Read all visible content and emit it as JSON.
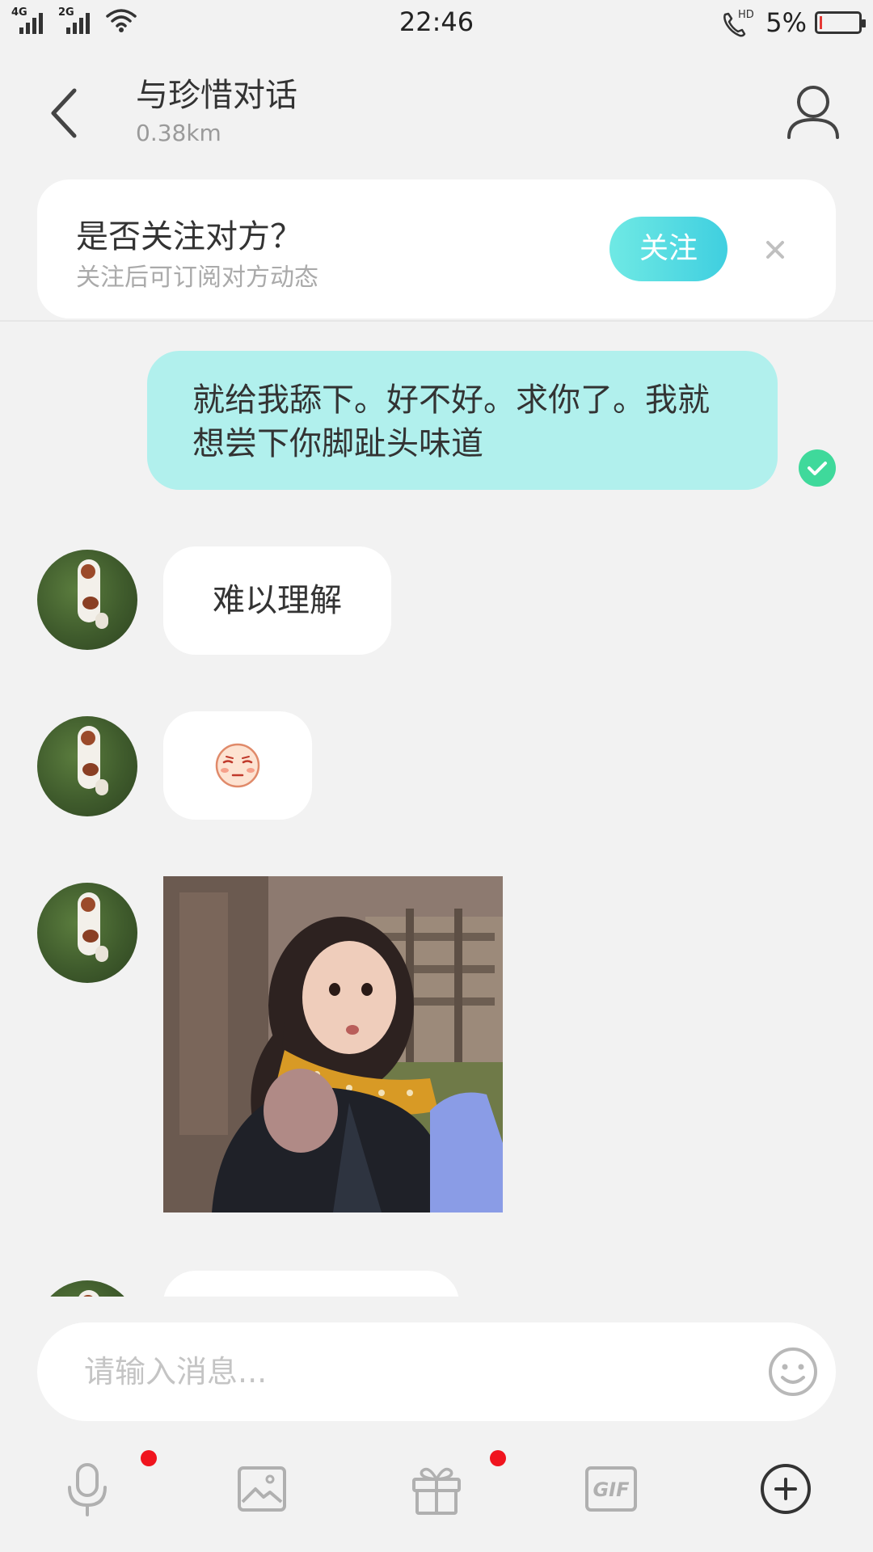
{
  "status_bar": {
    "network_1": "4G",
    "network_2": "2G",
    "time": "22:46",
    "hd": "HD",
    "battery_percent": "5%",
    "battery_level": 0.05,
    "battery_color": "#e53935"
  },
  "header": {
    "back_icon": "chevron-left-icon",
    "title": "与珍惜对话",
    "subtitle": "0.38km",
    "profile_icon": "user-profile-icon"
  },
  "follow_card": {
    "title": "是否关注对方？",
    "subtitle": "关注后可订阅对方动态",
    "follow_label": "关注",
    "close_icon": "close-icon"
  },
  "messages": [
    {
      "direction": "out",
      "text": "就给我舔下。好不好。求你了。我就想尝下你脚趾头味道",
      "status_icon": "sent-check-icon"
    },
    {
      "direction": "in",
      "text": "难以理解"
    },
    {
      "direction": "in",
      "type": "emoji",
      "icon": "smirk-face-emoji-icon"
    },
    {
      "direction": "in",
      "type": "image",
      "icon": "photo-girl-scarf"
    },
    {
      "direction": "in",
      "type": "text",
      "partially_visible": true
    }
  ],
  "composer": {
    "placeholder": "请输入消息...",
    "emoji_icon": "smiley-icon"
  },
  "toolbar": {
    "items": [
      {
        "icon": "microphone-icon",
        "badge": true
      },
      {
        "icon": "image-icon",
        "badge": false
      },
      {
        "icon": "gift-icon",
        "badge": true
      },
      {
        "icon": "gif-icon",
        "label": "GIF",
        "badge": false
      },
      {
        "icon": "plus-circle-icon",
        "badge": false
      }
    ]
  },
  "colors": {
    "accent": "#3fcfe0",
    "outgoing_bubble": "#b1f0ed",
    "sent_check": "#3fd99b",
    "badge": "#f0141e",
    "background": "#f2f2f2"
  }
}
